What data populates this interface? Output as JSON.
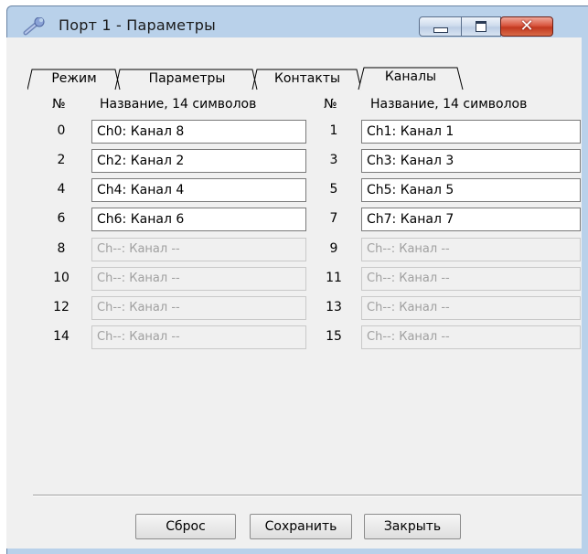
{
  "window": {
    "title": "Порт 1 - Параметры",
    "icon": "wrench-icon"
  },
  "tabs": [
    {
      "label": "Режим",
      "active": false
    },
    {
      "label": "Параметры",
      "active": false
    },
    {
      "label": "Контакты",
      "active": false
    },
    {
      "label": "Каналы",
      "active": true
    }
  ],
  "table": {
    "num_header": "№",
    "name_header": "Название, 14 символов",
    "rows": [
      {
        "left": {
          "num": "0",
          "name": "Ch0: Канал 8",
          "enabled": true
        },
        "right": {
          "num": "1",
          "name": "Ch1: Канал 1",
          "enabled": true
        }
      },
      {
        "left": {
          "num": "2",
          "name": "Ch2: Канал 2",
          "enabled": true
        },
        "right": {
          "num": "3",
          "name": "Ch3: Канал 3",
          "enabled": true
        }
      },
      {
        "left": {
          "num": "4",
          "name": "Ch4: Канал 4",
          "enabled": true
        },
        "right": {
          "num": "5",
          "name": "Ch5: Канал 5",
          "enabled": true
        }
      },
      {
        "left": {
          "num": "6",
          "name": "Ch6: Канал 6",
          "enabled": true
        },
        "right": {
          "num": "7",
          "name": "Ch7: Канал 7",
          "enabled": true
        }
      },
      {
        "left": {
          "num": "8",
          "name": "Ch--: Канал --",
          "enabled": false
        },
        "right": {
          "num": "9",
          "name": "Ch--: Канал --",
          "enabled": false
        }
      },
      {
        "left": {
          "num": "10",
          "name": "Ch--: Канал --",
          "enabled": false
        },
        "right": {
          "num": "11",
          "name": "Ch--: Канал --",
          "enabled": false
        }
      },
      {
        "left": {
          "num": "12",
          "name": "Ch--: Канал --",
          "enabled": false
        },
        "right": {
          "num": "13",
          "name": "Ch--: Канал --",
          "enabled": false
        }
      },
      {
        "left": {
          "num": "14",
          "name": "Ch--: Канал --",
          "enabled": false
        },
        "right": {
          "num": "15",
          "name": "Ch--: Канал --",
          "enabled": false
        }
      }
    ]
  },
  "buttons": {
    "reset": "Сброс",
    "save": "Сохранить",
    "close": "Закрыть"
  },
  "colors": {
    "frame": "#b9d1ea",
    "close_button": "#c2381f",
    "disabled_text": "#a0a0a0"
  }
}
